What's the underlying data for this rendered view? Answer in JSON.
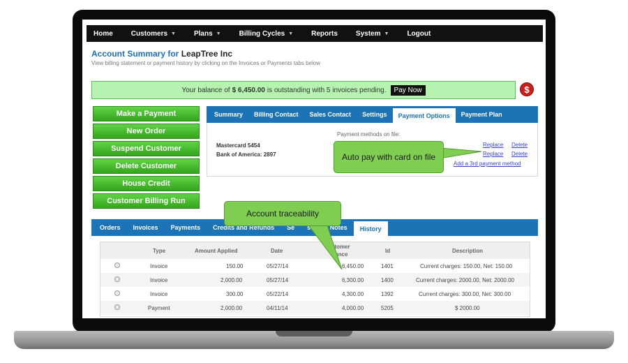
{
  "nav": {
    "items": [
      {
        "label": "Home",
        "dropdown": false
      },
      {
        "label": "Customers",
        "dropdown": true
      },
      {
        "label": "Plans",
        "dropdown": true
      },
      {
        "label": "Billing Cycles",
        "dropdown": true
      },
      {
        "label": "Reports",
        "dropdown": false
      },
      {
        "label": "System",
        "dropdown": true
      },
      {
        "label": "Logout",
        "dropdown": false
      }
    ]
  },
  "header": {
    "title_prefix": "Account Summary for ",
    "company": "LeapTree Inc",
    "subtitle": "View billing statement or payment history by clicking on the Invoices or Payments tabs below"
  },
  "balance": {
    "prefix": "Your balance of",
    "amount": "$ 6,450.00",
    "suffix": "is outstanding with 5 invoices pending.",
    "pay_now": "Pay Now",
    "icon": "$"
  },
  "actions": [
    "Make a Payment",
    "New Order",
    "Suspend Customer",
    "Delete Customer",
    "House Credit",
    "Customer Billing Run"
  ],
  "account_tabs": {
    "items": [
      "Summary",
      "Billing Contact",
      "Sales Contact",
      "Settings",
      "Payment Options",
      "Payment Plan"
    ],
    "active": "Payment Options"
  },
  "payment_options": {
    "cards": [
      "Mastercard 5454",
      "Bank of America: 2897"
    ],
    "methods_label": "Payment methods on file:",
    "replace": "Replace",
    "delete": "Delete",
    "add_method": "Add a 3rd payment method"
  },
  "callouts": {
    "autopay": "Auto pay with card on file",
    "traceability": "Account traceability"
  },
  "history_tabs": {
    "items": [
      "Orders",
      "Invoices",
      "Payments",
      "Credits and Refunds",
      "Se",
      "stomer Notes",
      "History"
    ],
    "active": "History"
  },
  "history_table": {
    "columns": [
      "Type",
      "Amount Applied",
      "Date",
      "ustomer",
      "lance",
      "Id",
      "Description"
    ],
    "rows": [
      {
        "type": "Invoice",
        "amount": "150.00",
        "date": "05/27/14",
        "balance": "6,450.00",
        "id": "1401",
        "description": "Current charges: 150.00, Net: 150.00"
      },
      {
        "type": "Invoice",
        "amount": "2,000.00",
        "date": "05/27/14",
        "balance": "6,300.00",
        "id": "1400",
        "description": "Current charges: 2000.00, Net: 2000.00"
      },
      {
        "type": "Invoice",
        "amount": "300.00",
        "date": "05/22/14",
        "balance": "4,300.00",
        "id": "1392",
        "description": "Current charges: 300.00, Net: 300.00"
      },
      {
        "type": "Payment",
        "amount": "2,000.00",
        "date": "04/11/14",
        "balance": "4,000.00",
        "id": "5205",
        "description": "$ 2000.00"
      }
    ]
  }
}
